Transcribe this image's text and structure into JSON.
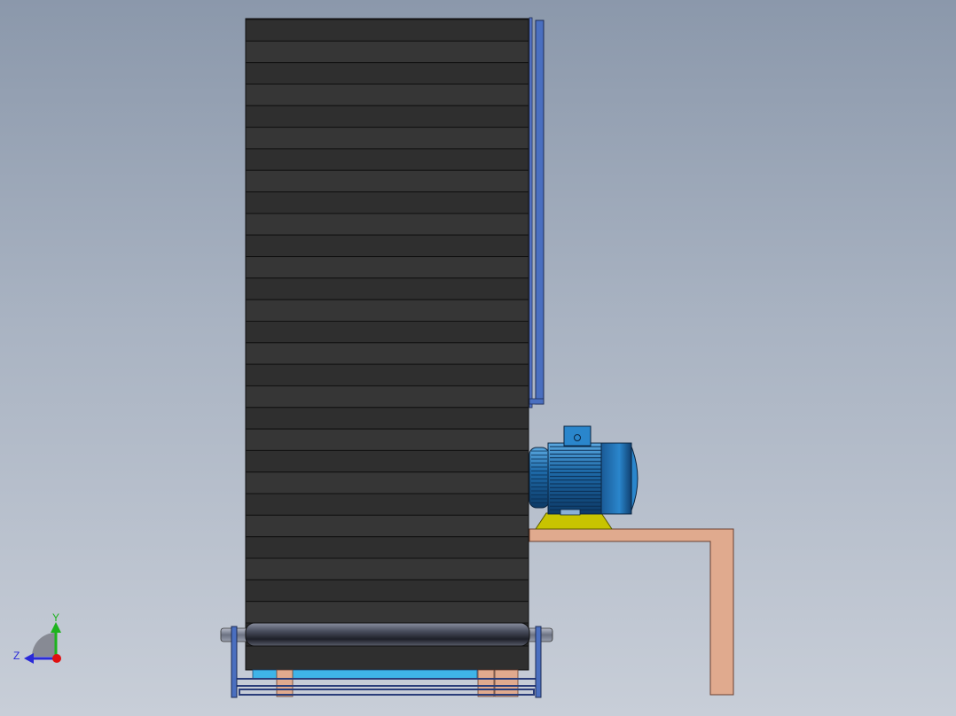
{
  "viewport": {
    "triad": {
      "y_label": "Y",
      "z_label": "Z",
      "y_color": "#1db31d",
      "z_color": "#2a2ad8",
      "x_color": "#e01010"
    }
  },
  "model": {
    "belt_color": "#2e2e2e",
    "belt_slat_count": 28,
    "frame_color": "#4a6fc0",
    "motor_color": "#1e6aa8",
    "motor_base_color": "#c8c400",
    "support_color": "#e0aa8e",
    "roller_color": "#3a3d48",
    "base_plate_color": "#3fb4e8"
  }
}
